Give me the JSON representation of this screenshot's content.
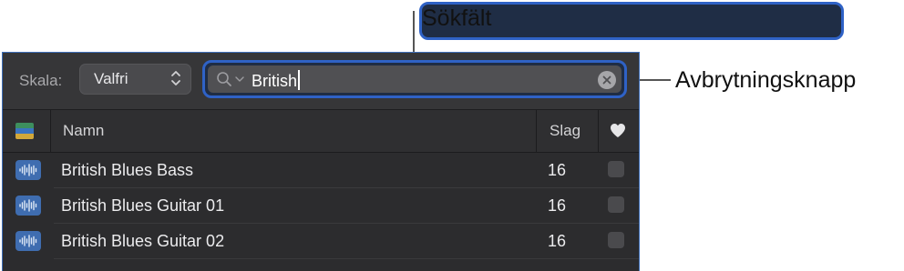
{
  "callouts": {
    "search_field": "Sökfält",
    "cancel_button": "Avbrytningsknapp"
  },
  "toolbar": {
    "scale_label": "Skala:",
    "scale_value": "Valfri",
    "search_value": "British"
  },
  "table": {
    "columns": [
      "Namn",
      "Slag"
    ],
    "rows": [
      {
        "name": "British Blues Bass",
        "slag": "16",
        "favorite": false
      },
      {
        "name": "British Blues Guitar 01",
        "slag": "16",
        "favorite": false
      },
      {
        "name": "British Blues Guitar 02",
        "slag": "16",
        "favorite": false
      }
    ]
  },
  "icons": {
    "search": "magnifier-icon",
    "clear": "clear-search-icon",
    "favorite_header": "heart-icon",
    "row_type": "audio-waveform-icon",
    "color_column": "color-stripes-icon"
  },
  "colors": {
    "panel_bg": "#2c2c2e",
    "focus_ring": "#2f62c6",
    "row_icon": "#3f6db0"
  }
}
